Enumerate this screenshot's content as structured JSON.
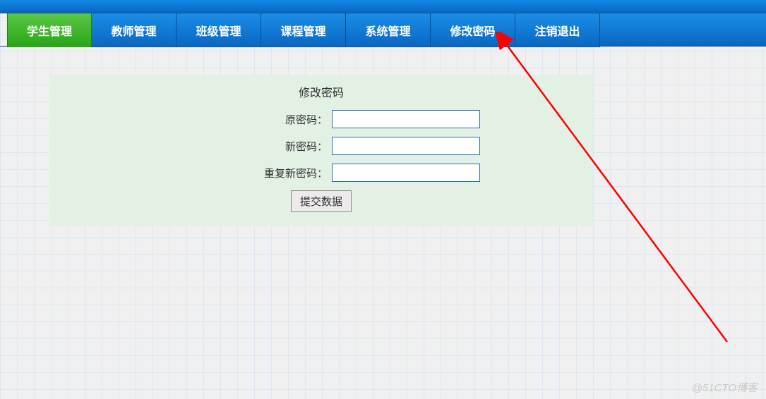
{
  "nav": {
    "items": [
      {
        "label": "学生管理",
        "active": true
      },
      {
        "label": "教师管理"
      },
      {
        "label": "班级管理"
      },
      {
        "label": "课程管理"
      },
      {
        "label": "系统管理"
      },
      {
        "label": "修改密码"
      },
      {
        "label": "注销退出"
      }
    ]
  },
  "form": {
    "title": "修改密码",
    "old_password_label": "原密码：",
    "new_password_label": "新密码：",
    "repeat_password_label": "重复新密码：",
    "old_password_value": "",
    "new_password_value": "",
    "repeat_password_value": "",
    "submit_label": "提交数据"
  },
  "watermark": "@51CTO博客",
  "annotation": {
    "arrow_color": "#ff0000"
  }
}
